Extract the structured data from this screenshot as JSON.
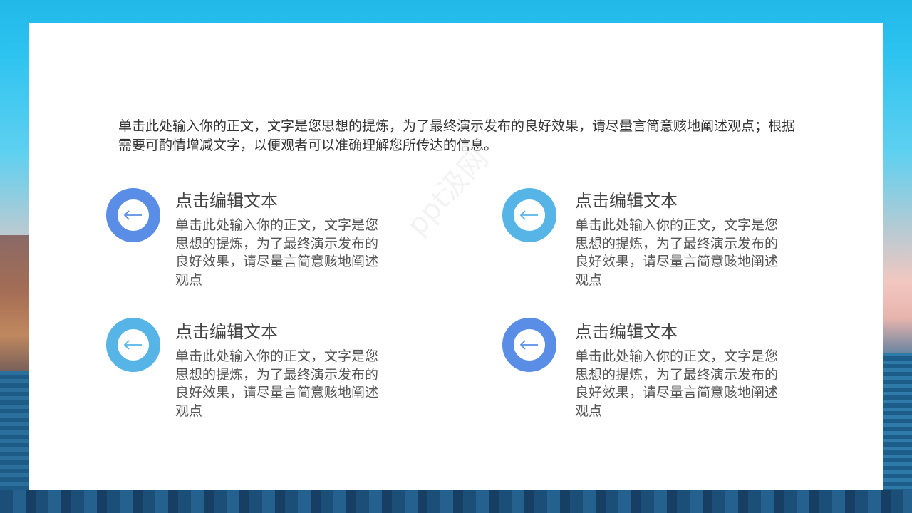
{
  "intro_text": "单击此处输入你的正文，文字是您思想的提炼，为了最终演示发布的良好效果，请尽量言简意赅地阐述观点；根据需要可酌情增减文字，以便观者可以准确理解您所传达的信息。",
  "items": [
    {
      "title": "点击编辑文本",
      "body": "单击此处输入你的正文，文字是您思想的提炼，为了最终演示发布的良好效果，请尽量言简意赅地阐述观点",
      "icon": "arrow-left-icon",
      "color": "#5a8ee6"
    },
    {
      "title": "点击编辑文本",
      "body": "单击此处输入你的正文，文字是您思想的提炼，为了最终演示发布的良好效果，请尽量言简意赅地阐述观点",
      "icon": "arrow-left-icon",
      "color": "#56b5e6"
    },
    {
      "title": "点击编辑文本",
      "body": "单击此处输入你的正文，文字是您思想的提炼，为了最终演示发布的良好效果，请尽量言简意赅地阐述观点",
      "icon": "arrow-left-icon",
      "color": "#56b5e6"
    },
    {
      "title": "点击编辑文本",
      "body": "单击此处输入你的正文，文字是您思想的提炼，为了最终演示发布的良好效果，请尽量言简意赅地阐述观点",
      "icon": "arrow-left-icon",
      "color": "#5a8ee6"
    }
  ],
  "watermark": "ppt汲网"
}
